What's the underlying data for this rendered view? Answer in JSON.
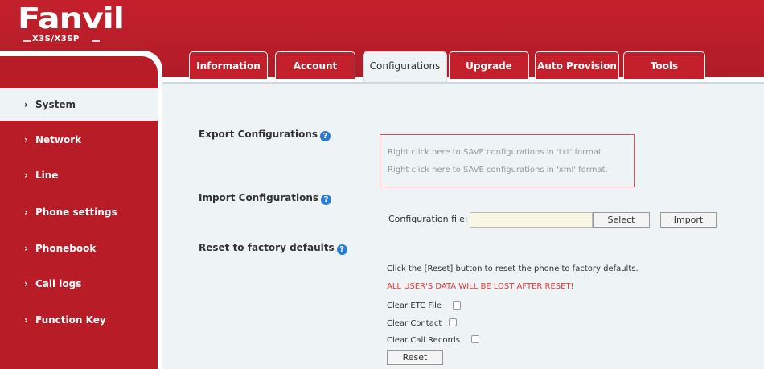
{
  "brand": {
    "logo_text": "Fanvil",
    "model": "X3S/X3SP"
  },
  "tabs": [
    {
      "label": "Information"
    },
    {
      "label": "Account"
    },
    {
      "label": "Configurations"
    },
    {
      "label": "Upgrade"
    },
    {
      "label": "Auto Provision"
    },
    {
      "label": "Tools"
    }
  ],
  "sidebar": {
    "items": [
      {
        "label": "System"
      },
      {
        "label": "Network"
      },
      {
        "label": "Line"
      },
      {
        "label": "Phone settings"
      },
      {
        "label": "Phonebook"
      },
      {
        "label": "Call logs"
      },
      {
        "label": "Function Key"
      }
    ]
  },
  "export": {
    "title": "Export Configurations",
    "link_txt": "Right click here to SAVE configurations in 'txt' format.",
    "link_xml": "Right click here to SAVE configurations in 'xml' format."
  },
  "import": {
    "title": "Import Configurations",
    "file_label": "Configuration file:",
    "file_value": "",
    "select_label": "Select",
    "import_label": "Import"
  },
  "reset": {
    "title": "Reset to factory defaults",
    "info": "Click the [Reset] button to reset the phone to factory defaults.",
    "warning": "ALL USER'S DATA WILL BE LOST AFTER RESET!",
    "clear_etc": "Clear ETC File",
    "clear_contact": "Clear Contact",
    "clear_call_records": "Clear Call Records",
    "reset_label": "Reset"
  },
  "colors": {
    "brand_red": "#b71c27",
    "panel_bg": "#eef3f5",
    "help_blue": "#2a7bd3",
    "warning_red": "#e53935"
  }
}
